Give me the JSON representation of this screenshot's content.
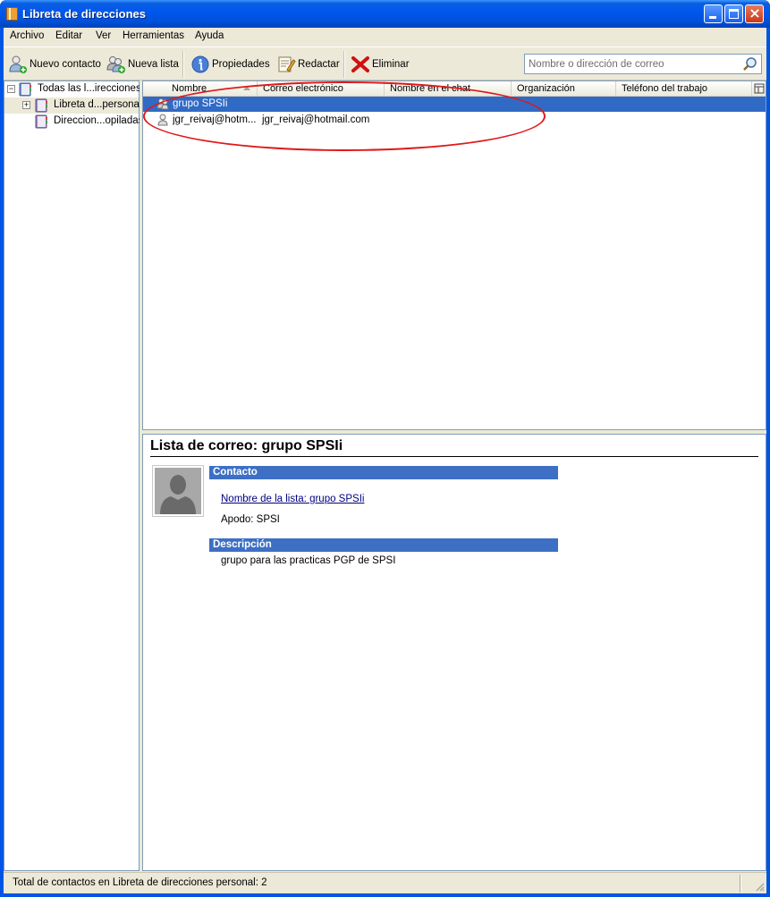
{
  "window": {
    "title": "Libreta de direcciones"
  },
  "menu": {
    "items": [
      "Archivo",
      "Editar",
      "Ver",
      "Herramientas",
      "Ayuda"
    ]
  },
  "toolbar": {
    "new_contact": "Nuevo contacto",
    "new_list": "Nueva lista",
    "properties": "Propiedades",
    "compose": "Redactar",
    "delete": "Eliminar",
    "search_placeholder": "Nombre o dirección de correo"
  },
  "tree": {
    "items": [
      {
        "label": "Todas las l...irecciones",
        "icon": "address-book-icon"
      },
      {
        "label": "Libreta d...personal",
        "icon": "address-book-icon"
      },
      {
        "label": "Direccion...opiladas",
        "icon": "address-book-icon"
      }
    ]
  },
  "list": {
    "columns": [
      "Nombre",
      "Correo electrónico",
      "Nombre en el chat",
      "Organización",
      "Teléfono del trabajo"
    ],
    "rows": [
      {
        "name": "grupo SPSIi",
        "email": "",
        "icon": "mailing-list-icon",
        "selected": true
      },
      {
        "name": "jgr_reivaj@hotm...",
        "email": "jgr_reivaj@hotmail.com",
        "icon": "contact-icon",
        "selected": false
      }
    ]
  },
  "detail": {
    "title": "Lista de correo: grupo SPSIi",
    "contact_header": "Contacto",
    "list_name": "Nombre de la lista: grupo SPSIi",
    "nickname": "Apodo: SPSI",
    "description_header": "Descripción",
    "description": "grupo para las practicas PGP de SPSI"
  },
  "status": {
    "text": "Total de contactos en Libreta de direcciones personal: 2"
  },
  "colors": {
    "titlebar": "#0058ee",
    "selection": "#316ac5",
    "section_header": "#3d6fc4",
    "annotation": "#e01818"
  }
}
